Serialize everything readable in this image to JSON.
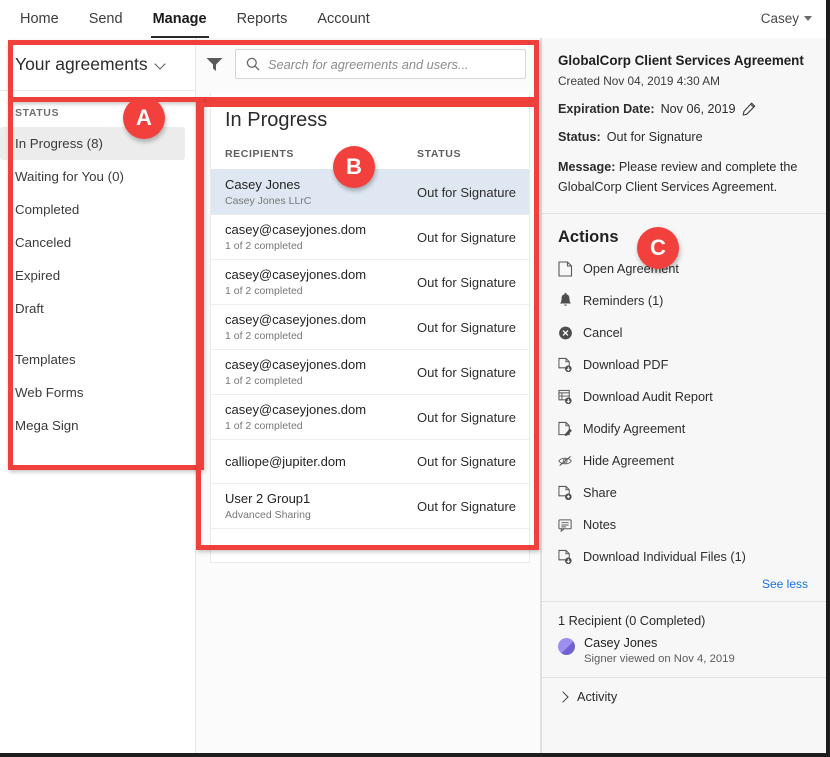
{
  "topnav": {
    "items": [
      {
        "label": "Home",
        "active": false
      },
      {
        "label": "Send",
        "active": false
      },
      {
        "label": "Manage",
        "active": true
      },
      {
        "label": "Reports",
        "active": false
      },
      {
        "label": "Account",
        "active": false
      }
    ],
    "user": "Casey"
  },
  "sidebar": {
    "header": "Your agreements",
    "status_label": "STATUS",
    "items": [
      {
        "label": "In Progress (8)",
        "selected": true
      },
      {
        "label": "Waiting for You (0)",
        "selected": false
      },
      {
        "label": "Completed",
        "selected": false
      },
      {
        "label": "Canceled",
        "selected": false
      },
      {
        "label": "Expired",
        "selected": false
      },
      {
        "label": "Draft",
        "selected": false
      }
    ],
    "items2": [
      {
        "label": "Templates"
      },
      {
        "label": "Web Forms"
      },
      {
        "label": "Mega Sign"
      }
    ]
  },
  "search": {
    "placeholder": "Search for agreements and users...",
    "value": ""
  },
  "list": {
    "title": "In Progress",
    "columns": [
      "RECIPIENTS",
      "STATUS"
    ],
    "rows": [
      {
        "name": "Casey Jones",
        "sub": "Casey Jones LLrC",
        "status": "Out for Signature",
        "selected": true
      },
      {
        "name": "casey@caseyjones.dom",
        "sub": "1 of 2 completed",
        "status": "Out for Signature",
        "selected": false
      },
      {
        "name": "casey@caseyjones.dom",
        "sub": "1 of 2 completed",
        "status": "Out for Signature",
        "selected": false
      },
      {
        "name": "casey@caseyjones.dom",
        "sub": "1 of 2 completed",
        "status": "Out for Signature",
        "selected": false
      },
      {
        "name": "casey@caseyjones.dom",
        "sub": "1 of 2 completed",
        "status": "Out for Signature",
        "selected": false
      },
      {
        "name": "casey@caseyjones.dom",
        "sub": "1 of 2 completed",
        "status": "Out for Signature",
        "selected": false
      },
      {
        "name": "calliope@jupiter.dom",
        "sub": "",
        "status": "Out for Signature",
        "selected": false
      },
      {
        "name": "User 2 Group1",
        "sub": "Advanced Sharing",
        "status": "Out for Signature",
        "selected": false
      }
    ]
  },
  "details": {
    "title": "GlobalCorp Client Services Agreement",
    "created": "Created Nov 04, 2019 4:30 AM",
    "expiration_label": "Expiration Date:",
    "expiration_value": "Nov 06, 2019",
    "status_label": "Status:",
    "status_value": "Out for Signature",
    "message_label": "Message:",
    "message_value": "Please review and complete the GlobalCorp Client Services Agreement."
  },
  "actions": {
    "heading": "Actions",
    "items": [
      {
        "label": "Open Agreement",
        "icon": "document-icon"
      },
      {
        "label": "Reminders (1)",
        "icon": "bell-icon"
      },
      {
        "label": "Cancel",
        "icon": "cancel-circle-icon"
      },
      {
        "label": "Download PDF",
        "icon": "download-pdf-icon"
      },
      {
        "label": "Download Audit Report",
        "icon": "download-audit-icon"
      },
      {
        "label": "Modify Agreement",
        "icon": "edit-document-icon"
      },
      {
        "label": "Hide Agreement",
        "icon": "eye-slash-icon"
      },
      {
        "label": "Share",
        "icon": "share-document-icon"
      },
      {
        "label": "Notes",
        "icon": "notes-icon"
      },
      {
        "label": "Download Individual Files (1)",
        "icon": "download-files-icon"
      }
    ],
    "see_less": "See less"
  },
  "recipients": {
    "heading": "1 Recipient (0 Completed)",
    "people": [
      {
        "name": "Casey Jones",
        "sub": "Signer viewed on Nov 4, 2019"
      }
    ]
  },
  "activity": {
    "label": "Activity"
  },
  "annotations": {
    "badges": [
      {
        "label": "A"
      },
      {
        "label": "B"
      },
      {
        "label": "C"
      }
    ],
    "accent_color": "#f0403c"
  }
}
